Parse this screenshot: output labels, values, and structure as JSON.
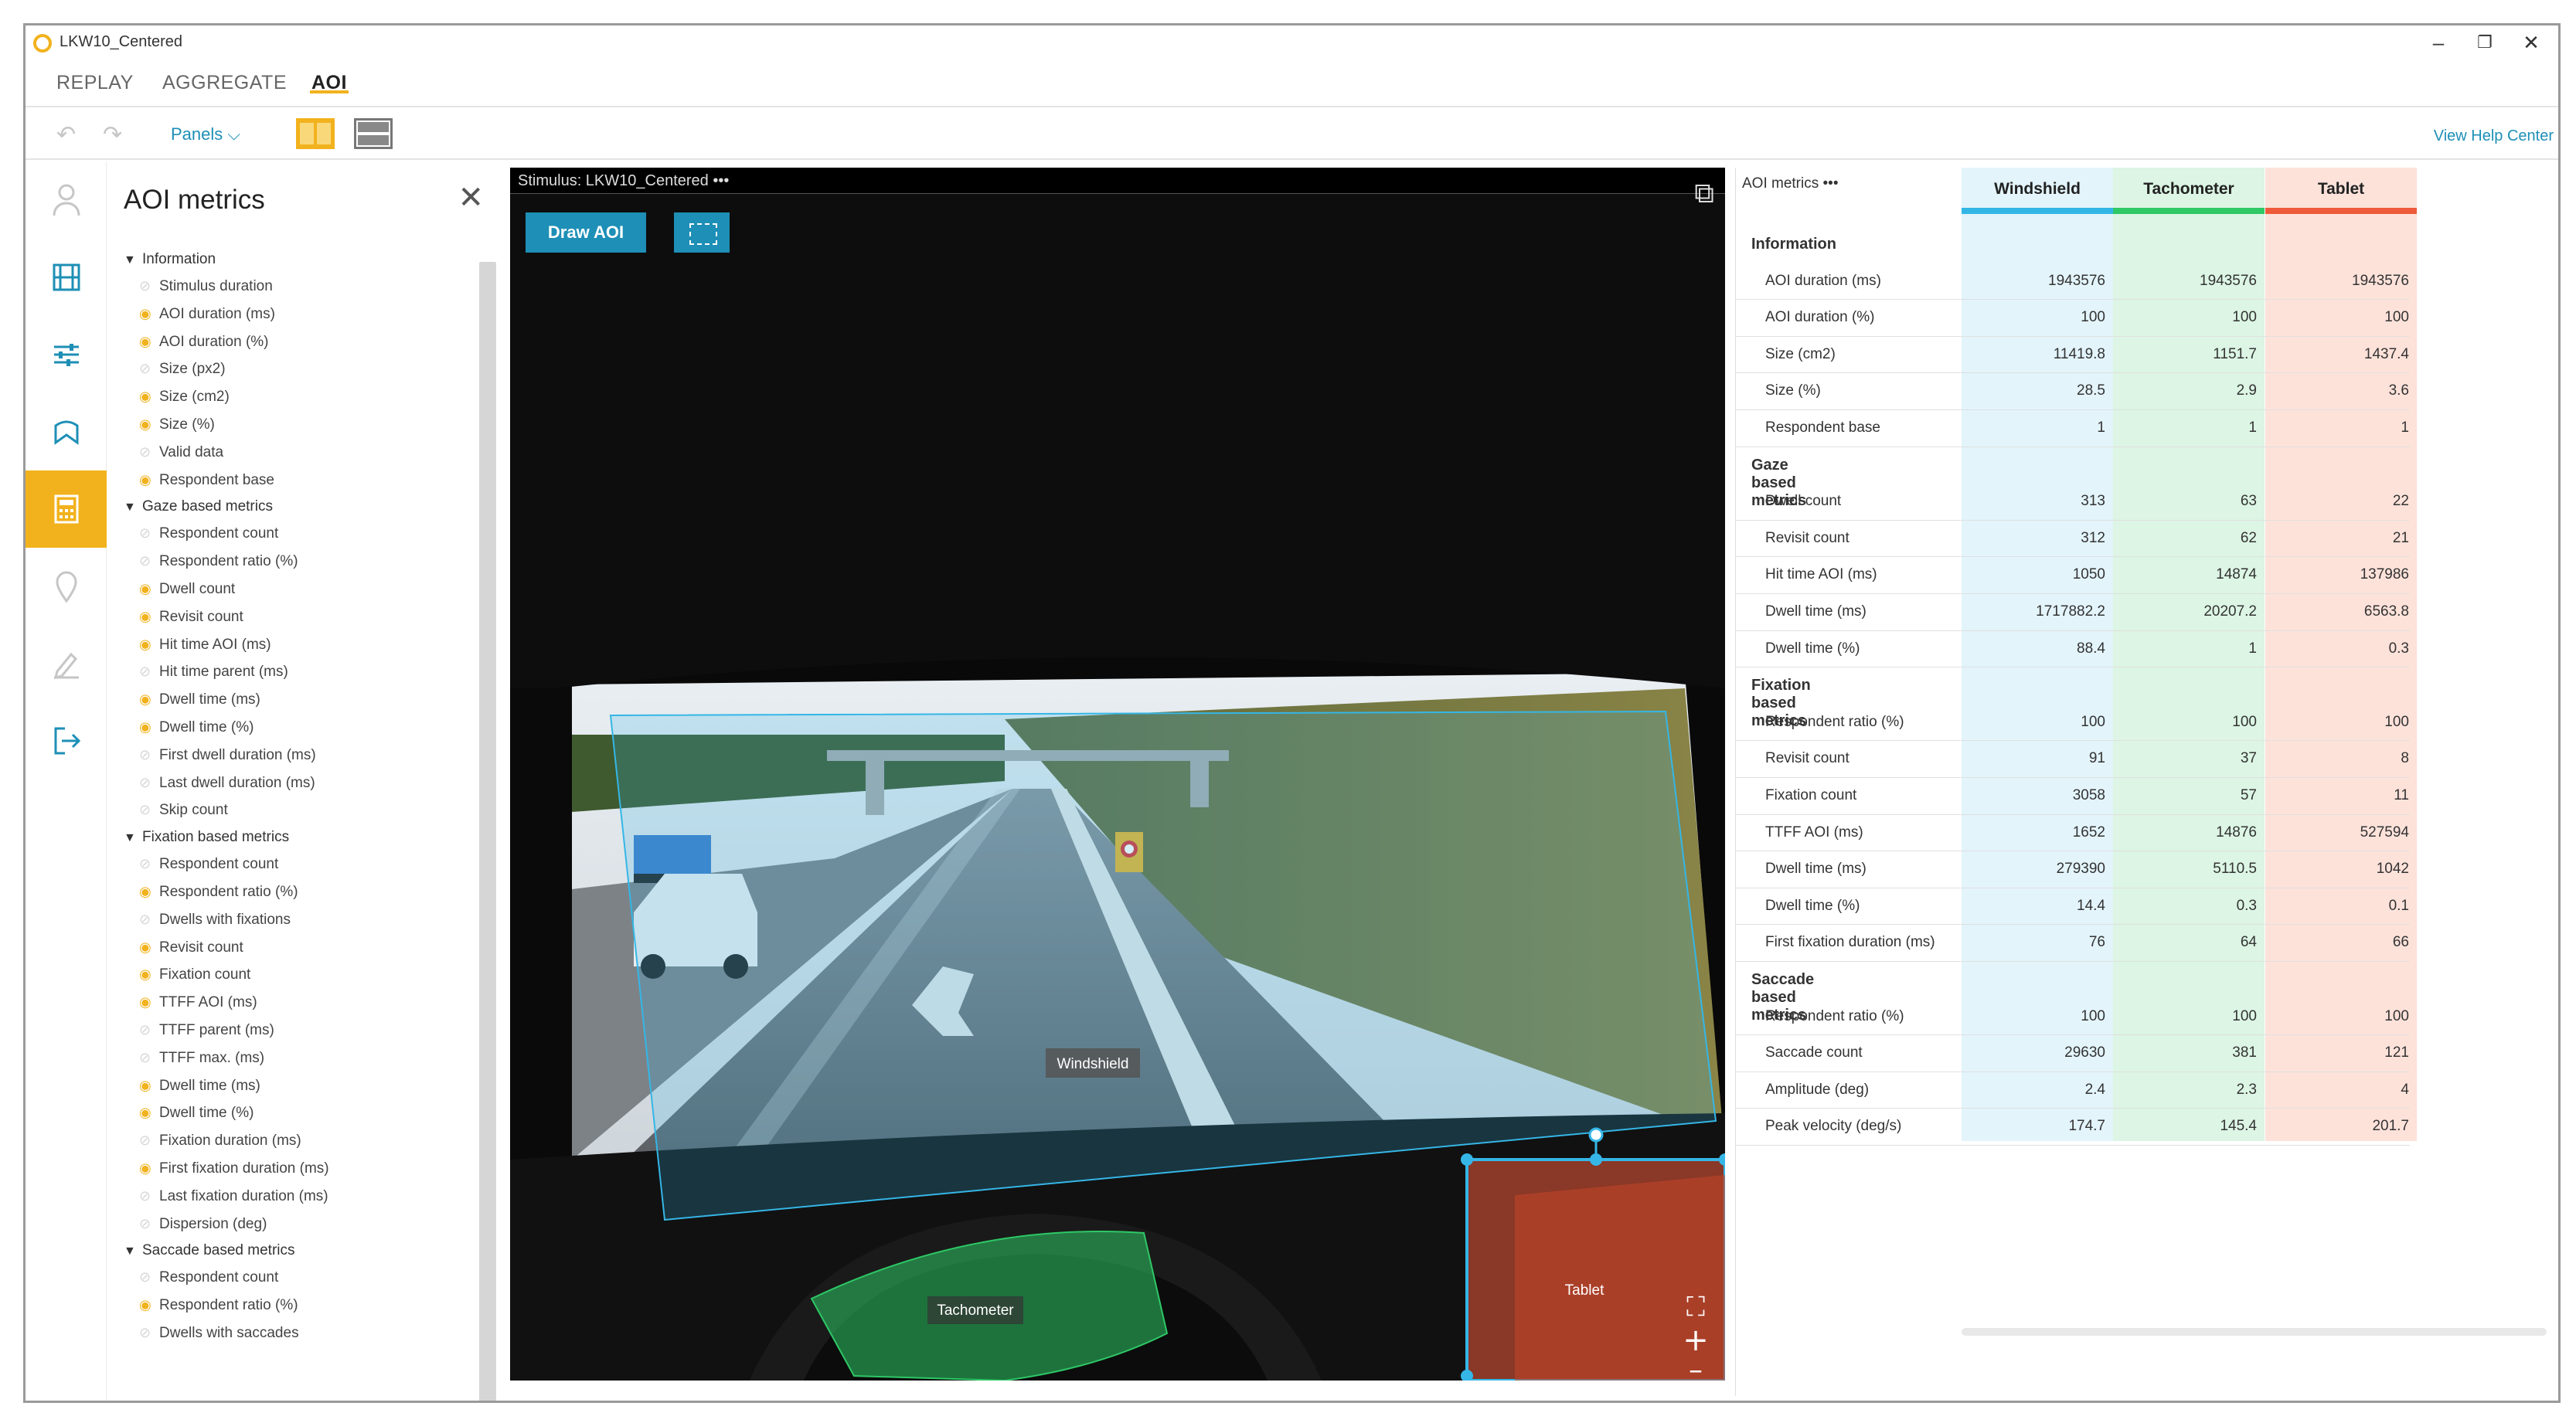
{
  "window": {
    "title": "LKW10_Centered",
    "minimize": "–",
    "restore": "❐",
    "close": "✕"
  },
  "menu": {
    "tabs": [
      "REPLAY",
      "AGGREGATE",
      "AOI"
    ],
    "active": "AOI"
  },
  "toolbar": {
    "undo": "↶",
    "redo": "↷",
    "panels_label": "Panels ⌵",
    "help_link": "View Help Center"
  },
  "rail": {
    "icons": [
      "person-icon",
      "film-icon",
      "sliders-icon",
      "map-icon",
      "calculator-icon",
      "pin-icon",
      "edit-icon",
      "export-icon"
    ],
    "active": "calculator-icon"
  },
  "selector": {
    "title": "AOI metrics",
    "close": "✕",
    "groups": [
      {
        "label": "Information",
        "items": [
          {
            "label": "Stimulus duration",
            "on": false
          },
          {
            "label": "AOI duration (ms)",
            "on": true
          },
          {
            "label": "AOI duration (%)",
            "on": true
          },
          {
            "label": "Size (px2)",
            "on": false
          },
          {
            "label": "Size (cm2)",
            "on": true
          },
          {
            "label": "Size (%)",
            "on": true
          },
          {
            "label": "Valid data",
            "on": false
          },
          {
            "label": "Respondent base",
            "on": true
          }
        ]
      },
      {
        "label": "Gaze based metrics",
        "items": [
          {
            "label": "Respondent count",
            "on": false
          },
          {
            "label": "Respondent ratio (%)",
            "on": false
          },
          {
            "label": "Dwell count",
            "on": true
          },
          {
            "label": "Revisit count",
            "on": true
          },
          {
            "label": "Hit time AOI (ms)",
            "on": true
          },
          {
            "label": "Hit time parent (ms)",
            "on": false
          },
          {
            "label": "Dwell time (ms)",
            "on": true
          },
          {
            "label": "Dwell time (%)",
            "on": true
          },
          {
            "label": "First dwell duration (ms)",
            "on": false
          },
          {
            "label": "Last dwell duration (ms)",
            "on": false
          },
          {
            "label": "Skip count",
            "on": false
          }
        ]
      },
      {
        "label": "Fixation based metrics",
        "items": [
          {
            "label": "Respondent count",
            "on": false
          },
          {
            "label": "Respondent ratio (%)",
            "on": true
          },
          {
            "label": "Dwells with fixations",
            "on": false
          },
          {
            "label": "Revisit count",
            "on": true
          },
          {
            "label": "Fixation count",
            "on": true
          },
          {
            "label": "TTFF AOI (ms)",
            "on": true
          },
          {
            "label": "TTFF parent (ms)",
            "on": false
          },
          {
            "label": "TTFF max. (ms)",
            "on": false
          },
          {
            "label": "Dwell time (ms)",
            "on": true
          },
          {
            "label": "Dwell time (%)",
            "on": true
          },
          {
            "label": "Fixation duration (ms)",
            "on": false
          },
          {
            "label": "First fixation duration (ms)",
            "on": true
          },
          {
            "label": "Last fixation duration (ms)",
            "on": false
          },
          {
            "label": "Dispersion (deg)",
            "on": false
          }
        ]
      },
      {
        "label": "Saccade based metrics",
        "items": [
          {
            "label": "Respondent count",
            "on": false
          },
          {
            "label": "Respondent ratio (%)",
            "on": true
          },
          {
            "label": "Dwells with saccades",
            "on": false
          }
        ]
      }
    ]
  },
  "stimulus": {
    "header": "Stimulus: LKW10_Centered  •••",
    "draw_aoi": "Draw AOI",
    "expand": "⧉",
    "aoi_labels": {
      "windshield": "Windshield",
      "tachometer": "Tachometer",
      "tablet": "Tablet"
    },
    "zoom_fit": "⛶",
    "zoom_in": "+",
    "zoom_out": "–"
  },
  "metrics": {
    "header": "AOI metrics  •••",
    "columns": [
      {
        "name": "Windshield",
        "color": "#33b6e6",
        "band": "#e3f4fb"
      },
      {
        "name": "Tachometer",
        "color": "#2ec866",
        "band": "#dcf5e4"
      },
      {
        "name": "Tablet",
        "color": "#ee5a3a",
        "band": "#fde2da"
      }
    ],
    "sections": [
      {
        "title": "Information",
        "rows": [
          {
            "label": "AOI duration (ms)",
            "values": [
              "1943576",
              "1943576",
              "1943576"
            ]
          },
          {
            "label": "AOI duration (%)",
            "values": [
              "100",
              "100",
              "100"
            ]
          },
          {
            "label": "Size (cm2)",
            "values": [
              "11419.8",
              "1151.7",
              "1437.4"
            ]
          },
          {
            "label": "Size (%)",
            "values": [
              "28.5",
              "2.9",
              "3.6"
            ]
          },
          {
            "label": "Respondent base",
            "values": [
              "1",
              "1",
              "1"
            ]
          }
        ]
      },
      {
        "title": "Gaze based metrics",
        "rows": [
          {
            "label": "Dwell count",
            "values": [
              "313",
              "63",
              "22"
            ]
          },
          {
            "label": "Revisit count",
            "values": [
              "312",
              "62",
              "21"
            ]
          },
          {
            "label": "Hit time AOI (ms)",
            "values": [
              "1050",
              "14874",
              "137986"
            ]
          },
          {
            "label": "Dwell time (ms)",
            "values": [
              "1717882.2",
              "20207.2",
              "6563.8"
            ]
          },
          {
            "label": "Dwell time (%)",
            "values": [
              "88.4",
              "1",
              "0.3"
            ]
          }
        ]
      },
      {
        "title": "Fixation based metrics",
        "rows": [
          {
            "label": "Respondent ratio (%)",
            "values": [
              "100",
              "100",
              "100"
            ]
          },
          {
            "label": "Revisit count",
            "values": [
              "91",
              "37",
              "8"
            ]
          },
          {
            "label": "Fixation count",
            "values": [
              "3058",
              "57",
              "11"
            ]
          },
          {
            "label": "TTFF AOI (ms)",
            "values": [
              "1652",
              "14876",
              "527594"
            ]
          },
          {
            "label": "Dwell time (ms)",
            "values": [
              "279390",
              "5110.5",
              "1042"
            ]
          },
          {
            "label": "Dwell time (%)",
            "values": [
              "14.4",
              "0.3",
              "0.1"
            ]
          },
          {
            "label": "First fixation duration (ms)",
            "values": [
              "76",
              "64",
              "66"
            ]
          }
        ]
      },
      {
        "title": "Saccade based metrics",
        "rows": [
          {
            "label": "Respondent ratio (%)",
            "values": [
              "100",
              "100",
              "100"
            ]
          },
          {
            "label": "Saccade count",
            "values": [
              "29630",
              "381",
              "121"
            ]
          },
          {
            "label": "Amplitude (deg)",
            "values": [
              "2.4",
              "2.3",
              "4"
            ]
          },
          {
            "label": "Peak velocity (deg/s)",
            "values": [
              "174.7",
              "145.4",
              "201.7"
            ]
          }
        ]
      }
    ]
  }
}
